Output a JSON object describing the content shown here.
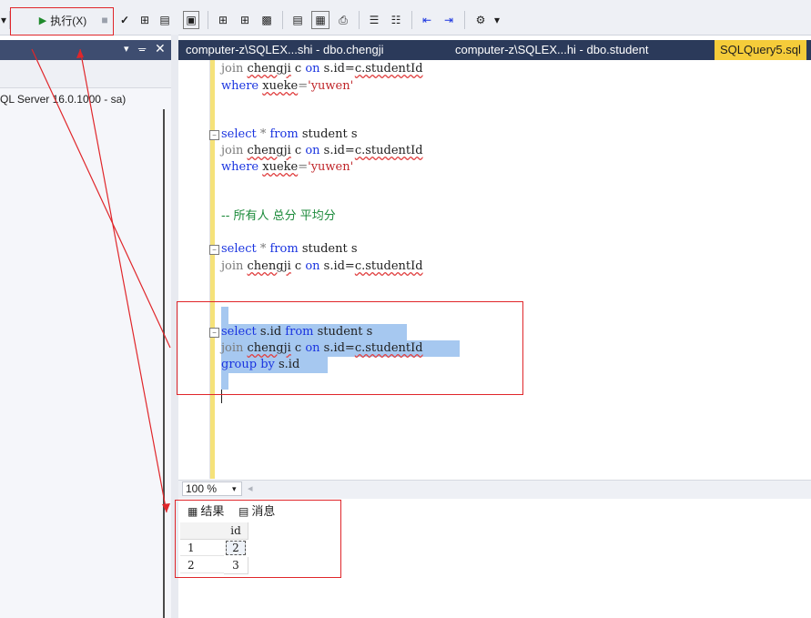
{
  "toolbar": {
    "execute_label": "执行(X)"
  },
  "left_pane": {
    "server_node": "QL Server 16.0.1000 - sa)"
  },
  "tabs": [
    {
      "label": "computer-z\\SQLEX...shi - dbo.chengji"
    },
    {
      "label": "computer-z\\SQLEX...hi - dbo.student"
    },
    {
      "label": "SQLQuery5.sql"
    }
  ],
  "editor": {
    "lines": {
      "l1_join": "join",
      "l1_tbl": "chengji",
      "l1_c": " c ",
      "l1_on": "on",
      "l1_rest": " s.id=",
      "l1_col": "c.studentId",
      "l2_where": "where",
      "l2_col": "xueke",
      "l2_eq": "=",
      "l2_str": "'yuwen'",
      "l3_select": "select",
      "l3_star": " * ",
      "l3_from": "from",
      "l3_rest": " student s",
      "l4_join": "join",
      "l4_tbl": "chengji",
      "l4_c": " c ",
      "l4_on": "on",
      "l4_rest": " s.id=",
      "l4_col": "c.studentId",
      "l5_where": "where",
      "l5_col": "xueke",
      "l5_eq": "=",
      "l5_str": "'yuwen'",
      "comment": "-- 所有人 总分 平均分",
      "l6_select": "select",
      "l6_star": " * ",
      "l6_from": "from",
      "l6_rest": " student s",
      "l7_join": "join",
      "l7_tbl": "chengji",
      "l7_c": " c ",
      "l7_on": "on",
      "l7_rest": " s.id=",
      "l7_col": "c.studentId",
      "l8_select": "select",
      "l8_mid": " s.id ",
      "l8_from": "from",
      "l8_rest": " student s",
      "l9_join": "join",
      "l9_tbl": "chengji",
      "l9_c": " c ",
      "l9_on": "on",
      "l9_rest": " s.id=",
      "l9_col": "c.studentId",
      "l10_group": "group by",
      "l10_rest": " s.id"
    }
  },
  "zoom": {
    "value": "100 %"
  },
  "results": {
    "tab_results": "结果",
    "tab_messages": "消息",
    "column_header": "id",
    "rows": [
      {
        "row_num": "1",
        "id": "2"
      },
      {
        "row_num": "2",
        "id": "3"
      }
    ]
  }
}
